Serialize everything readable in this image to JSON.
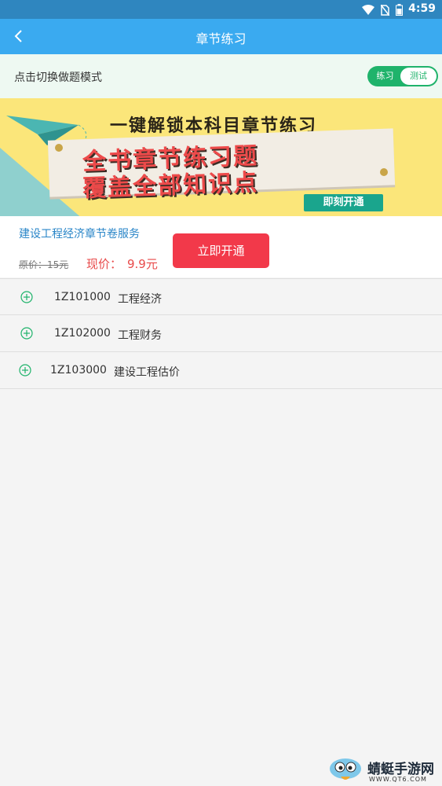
{
  "status_bar": {
    "time": "4:59",
    "icons": [
      "wifi-icon",
      "no-sim-icon",
      "battery-icon"
    ]
  },
  "app_bar": {
    "title": "章节练习",
    "back_icon": "chevron-left-icon"
  },
  "mode_bar": {
    "label": "点击切换做题模式",
    "toggle": {
      "practice": "练习",
      "test": "测试",
      "selected": "practice"
    }
  },
  "banner": {
    "headline": "一键解锁本科目章节练习",
    "line1": "全书章节练习题",
    "line2": "覆盖全部知识点",
    "cta": "即刻开通"
  },
  "offer": {
    "name": "建设工程经济章节卷服务",
    "original_price": "原价：15元",
    "current_label": "现价：",
    "current_price": "9.9元",
    "buy_label": "立即开通"
  },
  "chapters": [
    {
      "code": "1Z101000",
      "title": "工程经济"
    },
    {
      "code": "1Z102000",
      "title": "工程财务"
    },
    {
      "code": "1Z103000",
      "title": "建设工程估价"
    }
  ],
  "watermark": {
    "text": "蜻蜓手游网",
    "url": "WWW.QT6.COM"
  },
  "colors": {
    "app_bar": "#3aaaf0",
    "status_bar": "#2f86bf",
    "accent_green": "#1fb36b",
    "buy_red": "#f2394a",
    "price_red": "#e84a4a"
  }
}
